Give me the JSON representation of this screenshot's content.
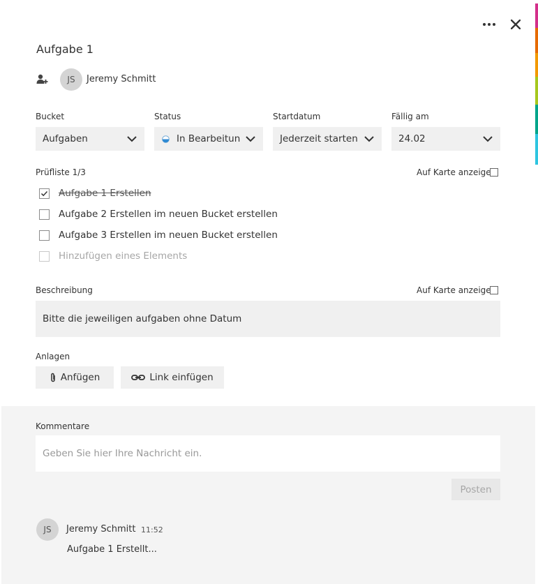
{
  "colors": {
    "edge_strip": [
      "#ffffff",
      "#d32f8a",
      "#e66a00",
      "#f29900",
      "#a6c81e",
      "#00a58a",
      "#2ec5e0",
      "#ffffff"
    ]
  },
  "header": {
    "more_icon": "more-icon",
    "close_icon": "close-icon"
  },
  "task": {
    "title": "Aufgabe 1"
  },
  "assignee": {
    "initials": "JS",
    "name": "Jeremy Schmitt"
  },
  "fields": {
    "bucket": {
      "label": "Bucket",
      "value": "Aufgaben"
    },
    "status": {
      "label": "Status",
      "value": "In Bearbeitun"
    },
    "start": {
      "label": "Startdatum",
      "value": "Jederzeit starten"
    },
    "due": {
      "label": "Fällig am",
      "value": "24.02"
    }
  },
  "checklist": {
    "label": "Prüfliste 1/3",
    "show_on_card": "Auf Karte anzeigen",
    "items": [
      {
        "text": "Aufgabe 1 Erstellen",
        "checked": true
      },
      {
        "text": "Aufgabe 2 Erstellen im neuen Bucket erstellen",
        "checked": false
      },
      {
        "text": "Aufgabe 3 Erstellen im neuen Bucket erstellen",
        "checked": false
      }
    ],
    "add_placeholder": "Hinzufügen eines Elements"
  },
  "description": {
    "label": "Beschreibung",
    "show_on_card": "Auf Karte anzeigen",
    "text": "Bitte die jeweiligen aufgaben ohne Datum"
  },
  "attachments": {
    "label": "Anlagen",
    "attach": "Anfügen",
    "link": "Link einfügen"
  },
  "comments": {
    "label": "Kommentare",
    "placeholder": "Geben Sie hier Ihre Nachricht ein.",
    "post": "Posten",
    "entries": [
      {
        "initials": "JS",
        "author": "Jeremy Schmitt",
        "time": "11:52",
        "text": "Aufgabe 1 Erstellt..."
      }
    ]
  }
}
